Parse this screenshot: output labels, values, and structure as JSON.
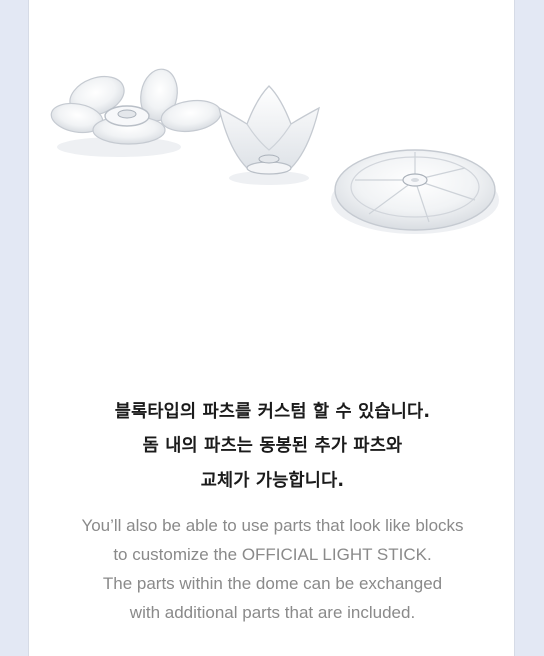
{
  "description": {
    "korean_lines": [
      "블록타입의 파츠를 커스텀 할 수 있습니다.",
      "돔 내의 파츠는 동봉된 추가 파츠와",
      "교체가 가능합니다."
    ],
    "english_lines": [
      "You’ll also be able to use parts that look like blocks",
      "to customize the OFFICIAL LIGHT STICK.",
      "The parts within the dome can be exchanged",
      "with additional parts that are included."
    ]
  },
  "colors": {
    "background": "#e3e8f4",
    "panel": "#ffffff",
    "korean_text": "#1b1b1b",
    "english_text": "#8a8a8a"
  }
}
